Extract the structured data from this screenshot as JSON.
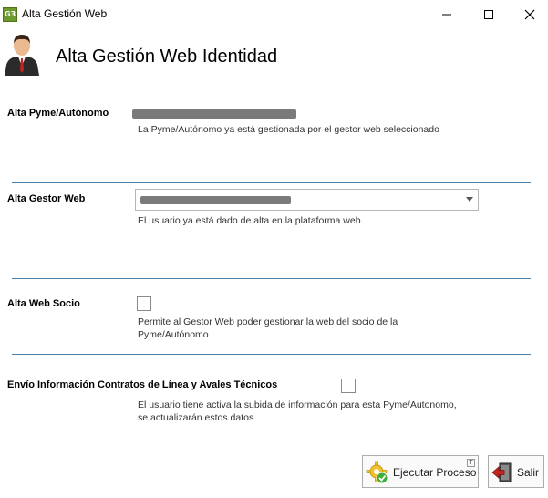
{
  "window": {
    "title": "Alta Gestión Web",
    "app_icon_text": "G3"
  },
  "header": {
    "title": "Alta Gestión Web Identidad",
    "icon": "user-avatar-icon"
  },
  "pyme": {
    "label": "Alta Pyme/Autónomo",
    "description": "La Pyme/Autónomo ya está gestionada por el gestor web seleccionado"
  },
  "gestor": {
    "label": "Alta Gestor Web",
    "selected_value": "",
    "description": "El usuario ya está dado de alta en la plataforma web."
  },
  "socio": {
    "label": "Alta Web Socio",
    "checked": false,
    "description_line1": "Permite al Gestor Web poder gestionar la web del socio de la",
    "description_line2": "Pyme/Autónomo"
  },
  "contratos": {
    "label": "Envío Información Contratos de Línea y Avales Técnicos",
    "checked": false,
    "description_line1": "El usuario tiene activa la subida de información para esta Pyme/Autonomo,",
    "description_line2": "se actualizarán estos datos"
  },
  "buttons": {
    "execute_label": "Ejecutar Proceso",
    "execute_hotkey": "T",
    "exit_label": "Salir"
  },
  "colors": {
    "separator": "#4b7fa8",
    "redaction": "#7a7a7a"
  }
}
